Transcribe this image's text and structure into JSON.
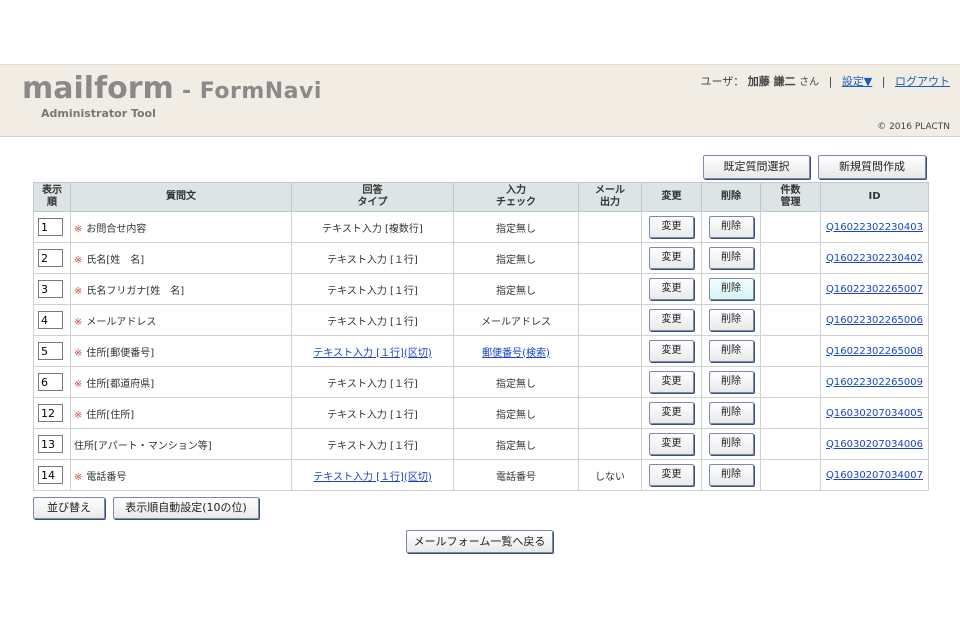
{
  "header": {
    "logo_main": "mailform",
    "logo_dash": " - ",
    "logo_product": "FormNavi",
    "logo_sub": "Administrator Tool",
    "user_label": "ユーザ：",
    "user_name": "加藤 謙二",
    "user_honorific": "さん",
    "separator": "|",
    "settings_link": "設定▼",
    "logout_link": "ログアウト",
    "copyright": "© 2016 PLACTN"
  },
  "toolbar": {
    "preset_button": "既定質問選択",
    "new_button": "新規質問作成"
  },
  "table": {
    "headers": {
      "order": "表示\n順",
      "question": "質問文",
      "answer_type": "回答\nタイプ",
      "input_check": "入力\nチェック",
      "mail_output": "メール\n出力",
      "edit": "変更",
      "delete": "削除",
      "count": "件数\n管理",
      "id": "ID"
    },
    "required_mark": "※",
    "edit_label": "変更",
    "delete_label": "削除",
    "rows": [
      {
        "order": "1",
        "required": true,
        "question": "お問合せ内容",
        "answer_type": "テキスト入力 [複数行]",
        "answer_link": false,
        "check": "指定無し",
        "check_link": false,
        "mail_output": "",
        "id": "Q16022302230403",
        "delete_active": false
      },
      {
        "order": "2",
        "required": true,
        "question": "氏名[姓　名]",
        "answer_type": "テキスト入力 [１行]",
        "answer_link": false,
        "check": "指定無し",
        "check_link": false,
        "mail_output": "",
        "id": "Q16022302230402",
        "delete_active": false
      },
      {
        "order": "3",
        "required": true,
        "question": "氏名フリガナ[姓　名]",
        "answer_type": "テキスト入力 [１行]",
        "answer_link": false,
        "check": "指定無し",
        "check_link": false,
        "mail_output": "",
        "id": "Q16022302265007",
        "delete_active": true
      },
      {
        "order": "4",
        "required": true,
        "question": "メールアドレス",
        "answer_type": "テキスト入力 [１行]",
        "answer_link": false,
        "check": "メールアドレス",
        "check_link": false,
        "mail_output": "",
        "id": "Q16022302265006",
        "delete_active": false
      },
      {
        "order": "5",
        "required": true,
        "question": "住所[郵便番号]",
        "answer_type": "テキスト入力 [１行](区切)",
        "answer_link": true,
        "check": "郵便番号(検索)",
        "check_link": true,
        "mail_output": "",
        "id": "Q16022302265008",
        "delete_active": false
      },
      {
        "order": "6",
        "required": true,
        "question": "住所[都道府県]",
        "answer_type": "テキスト入力 [１行]",
        "answer_link": false,
        "check": "指定無し",
        "check_link": false,
        "mail_output": "",
        "id": "Q16022302265009",
        "delete_active": false
      },
      {
        "order": "12",
        "required": true,
        "question": "住所[住所]",
        "answer_type": "テキスト入力 [１行]",
        "answer_link": false,
        "check": "指定無し",
        "check_link": false,
        "mail_output": "",
        "id": "Q16030207034005",
        "delete_active": false
      },
      {
        "order": "13",
        "required": false,
        "question": "住所[アパート・マンション等]",
        "answer_type": "テキスト入力 [１行]",
        "answer_link": false,
        "check": "指定無し",
        "check_link": false,
        "mail_output": "",
        "id": "Q16030207034006",
        "delete_active": false
      },
      {
        "order": "14",
        "required": true,
        "question": "電話番号",
        "answer_type": "テキスト入力 [１行](区切)",
        "answer_link": true,
        "check": "電話番号",
        "check_link": false,
        "mail_output": "しない",
        "id": "Q16030207034007",
        "delete_active": false
      }
    ]
  },
  "footer": {
    "sort_button": "並び替え",
    "auto_order_button": "表示順自動設定(10の位)",
    "back_button": "メールフォーム一覧へ戻る"
  }
}
